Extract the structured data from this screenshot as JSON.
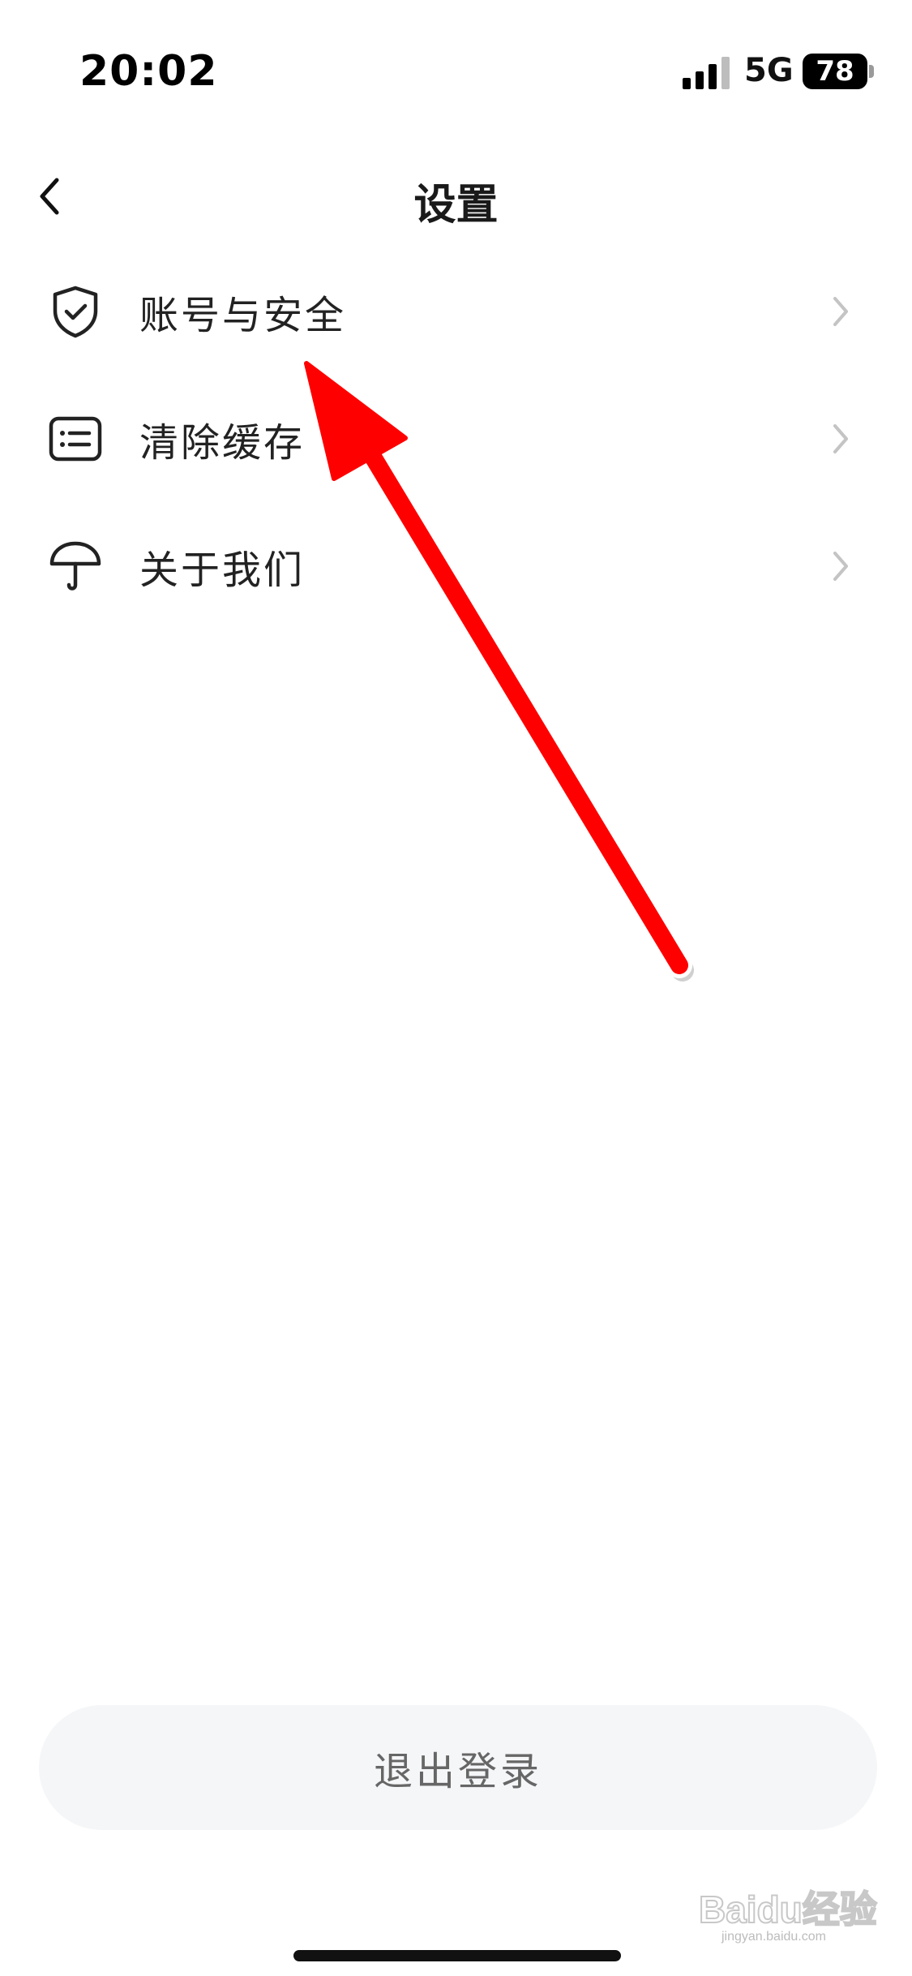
{
  "status_bar": {
    "time": "20:02",
    "network": "5G",
    "battery": "78"
  },
  "nav": {
    "title": "设置",
    "back_icon": "chevron-left-icon"
  },
  "settings": {
    "items": [
      {
        "label": "账号与安全",
        "icon": "shield-check-icon"
      },
      {
        "label": "清除缓存",
        "icon": "list-icon"
      },
      {
        "label": "关于我们",
        "icon": "umbrella-icon"
      }
    ]
  },
  "logout": {
    "label": "退出登录"
  },
  "watermark": {
    "text": "Baidu经验",
    "url": "jingyan.baidu.com"
  },
  "colors": {
    "background": "#ffffff",
    "text": "#1a1a1a",
    "chevron": "#c4c4c4",
    "logout_bg": "#f5f6f8",
    "logout_text": "#666666",
    "annotation_arrow": "#ff0000"
  }
}
